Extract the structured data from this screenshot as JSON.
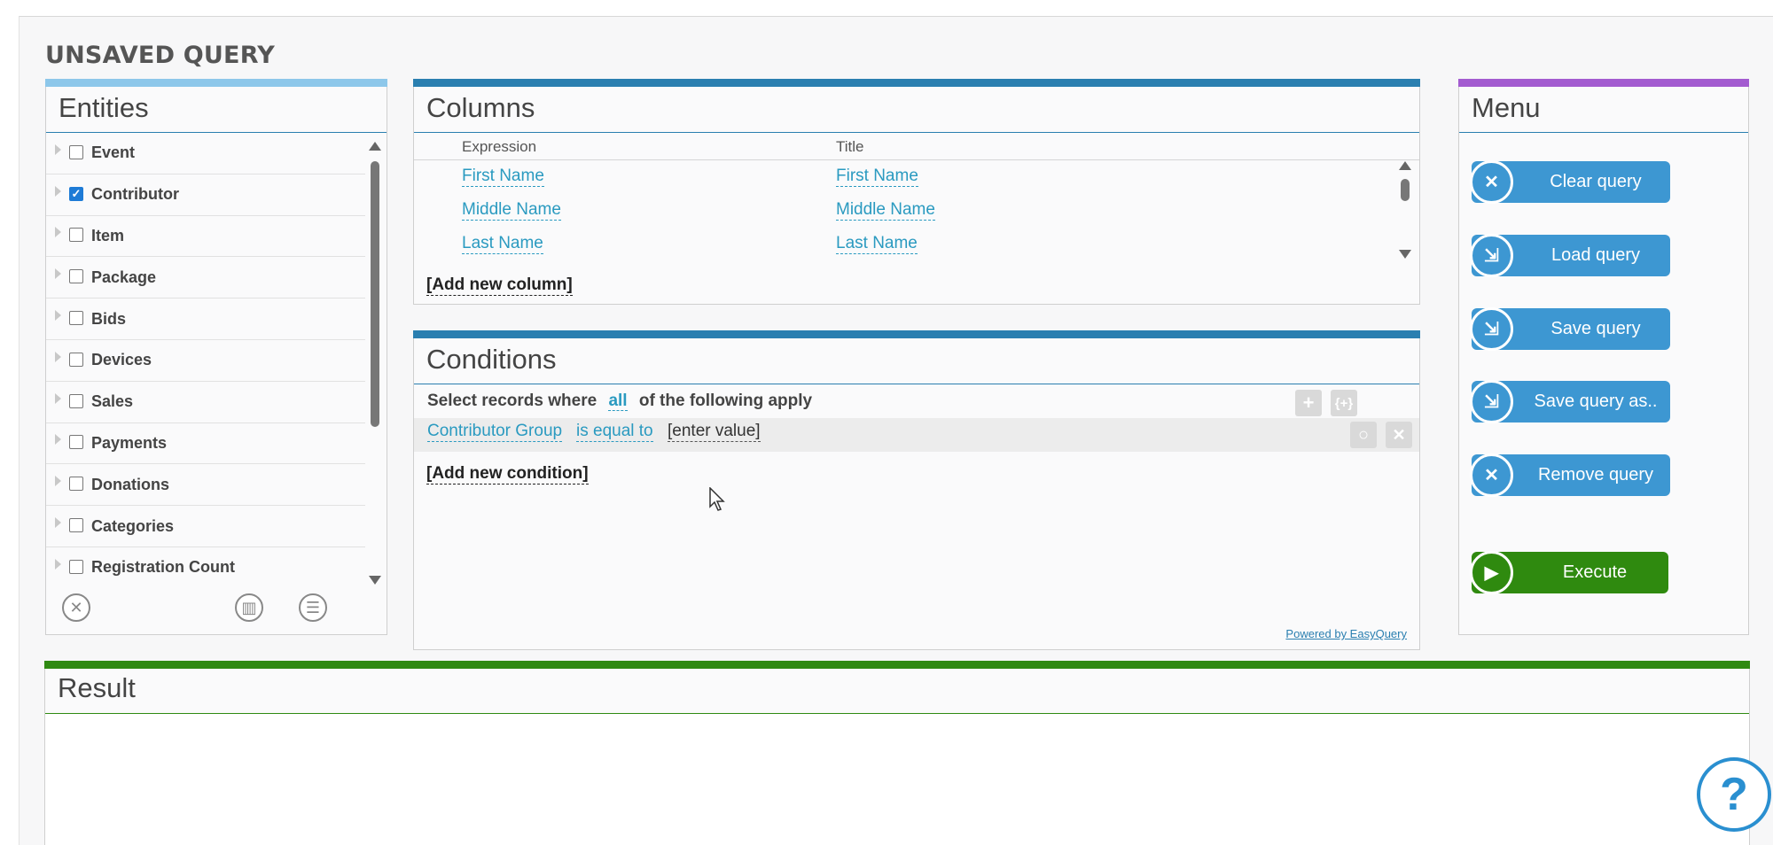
{
  "page": {
    "title": "UNSAVED QUERY"
  },
  "entities": {
    "title": "Entities",
    "items": [
      {
        "label": "Event",
        "checked": false
      },
      {
        "label": "Contributor",
        "checked": true
      },
      {
        "label": "Item",
        "checked": false
      },
      {
        "label": "Package",
        "checked": false
      },
      {
        "label": "Bids",
        "checked": false
      },
      {
        "label": "Devices",
        "checked": false
      },
      {
        "label": "Sales",
        "checked": false
      },
      {
        "label": "Payments",
        "checked": false
      },
      {
        "label": "Donations",
        "checked": false
      },
      {
        "label": "Categories",
        "checked": false
      },
      {
        "label": "Registration Count",
        "checked": false
      }
    ]
  },
  "columns": {
    "title": "Columns",
    "header": {
      "expression": "Expression",
      "title": "Title"
    },
    "rows": [
      {
        "expression": "First Name",
        "title": "First Name"
      },
      {
        "expression": "Middle Name",
        "title": "Middle Name"
      },
      {
        "expression": "Last Name",
        "title": "Last Name"
      }
    ],
    "add_label": "[Add new column]"
  },
  "conditions": {
    "title": "Conditions",
    "head_prefix": "Select records where",
    "head_link": "all",
    "head_suffix": "of the following apply",
    "row": {
      "field": "Contributor Group",
      "operator": "is equal to",
      "value": "[enter value]"
    },
    "add_label": "[Add new condition]",
    "powered_by": "Powered by EasyQuery"
  },
  "menu": {
    "title": "Menu",
    "buttons": [
      {
        "label": "Clear query",
        "icon": "clear-icon"
      },
      {
        "label": "Load query",
        "icon": "load-icon"
      },
      {
        "label": "Save query",
        "icon": "save-icon"
      },
      {
        "label": "Save query as..",
        "icon": "save-as-icon"
      },
      {
        "label": "Remove query",
        "icon": "remove-icon"
      }
    ],
    "execute_label": "Execute"
  },
  "result": {
    "title": "Result"
  },
  "help": {
    "label": "?"
  },
  "colors": {
    "entities_accent": "#8dc7ea",
    "columns_accent": "#2a7fb0",
    "menu_accent": "#a35bd0",
    "result_accent": "#2f8a12",
    "menu_button": "#3d97d2",
    "execute_button": "#2f8a0f"
  }
}
